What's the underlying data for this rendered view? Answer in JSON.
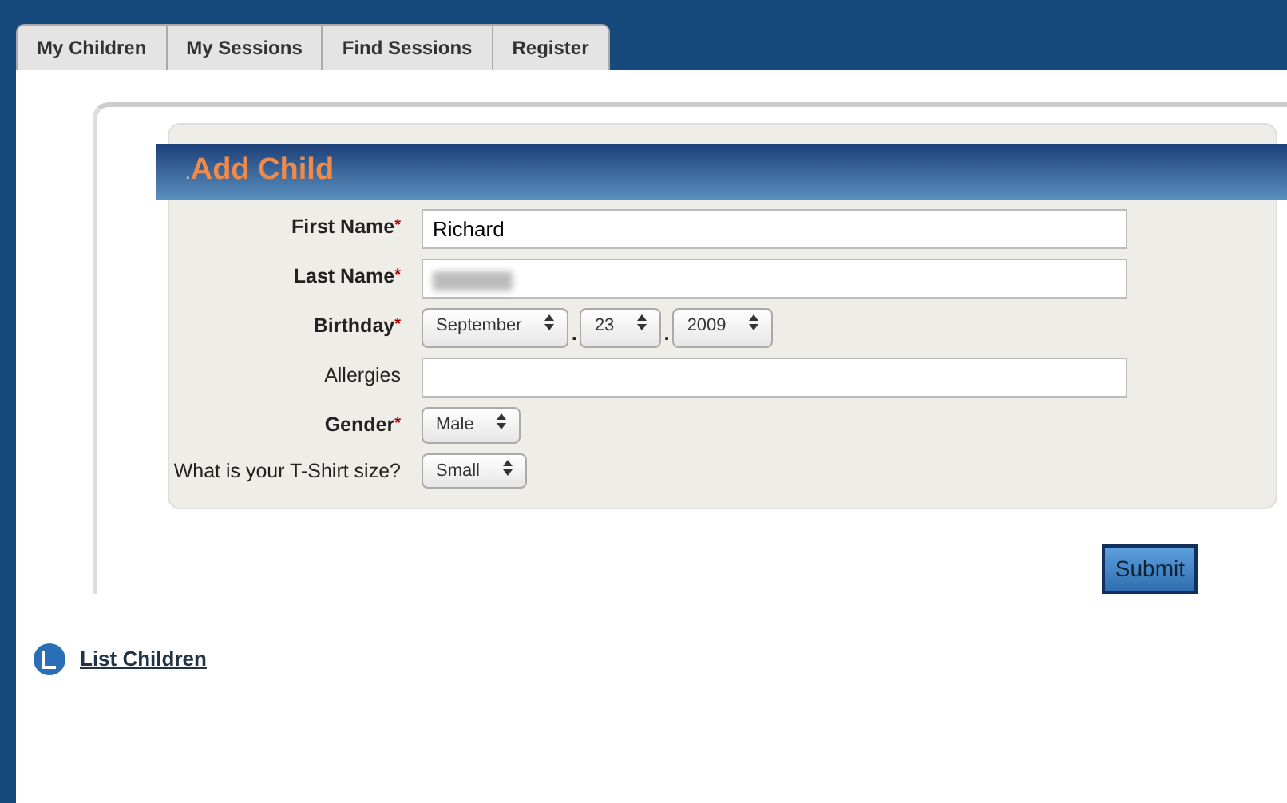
{
  "tabs": [
    {
      "label": "My Children",
      "selected": false
    },
    {
      "label": "My Sessions",
      "selected": false
    },
    {
      "label": "Find Sessions",
      "selected": false
    },
    {
      "label": "Register",
      "selected": false
    }
  ],
  "form": {
    "title": "Add Child",
    "title_prefix": ".",
    "fields": [
      {
        "label": "First Name",
        "required": true,
        "required_mark": "*",
        "kind": "text",
        "value": "Richard"
      },
      {
        "label": "Last Name",
        "required": true,
        "required_mark": "*",
        "kind": "redacted"
      },
      {
        "label": "Birthday",
        "required": true,
        "required_mark": "*",
        "kind": "selects",
        "separator": ".",
        "values": [
          "September",
          "23",
          "2009"
        ]
      },
      {
        "label": "Allergies",
        "required": false,
        "kind": "text"
      },
      {
        "label": "Gender",
        "required": true,
        "required_mark": "*",
        "kind": "selects",
        "values": [
          "Male"
        ]
      },
      {
        "label": "What is your T-Shirt size?",
        "required": false,
        "kind": "selects",
        "values": [
          "Small"
        ]
      }
    ],
    "submit": "Submit"
  },
  "footer_link": "List Children"
}
